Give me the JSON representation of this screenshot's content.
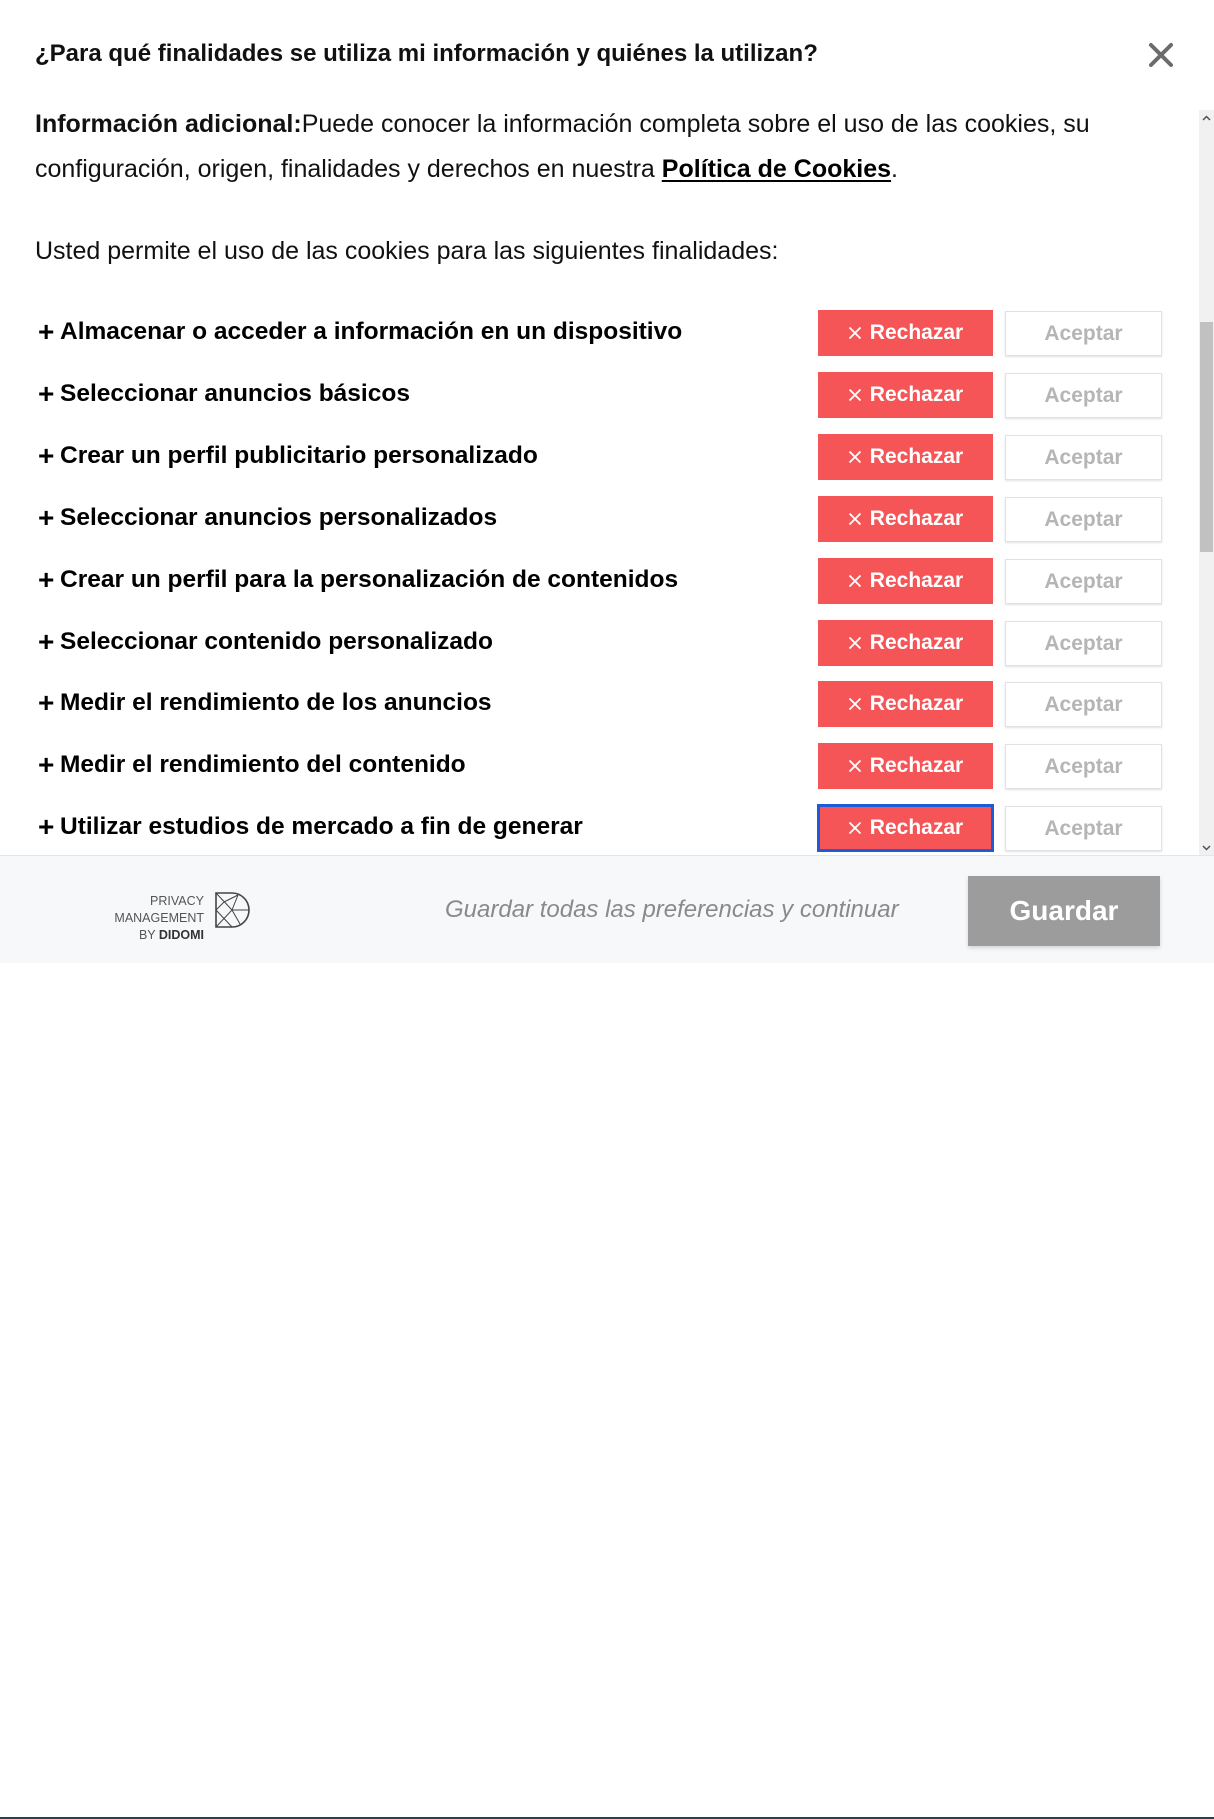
{
  "dialog": {
    "title": "¿Para qué finalidades se utiliza mi información y quiénes la utilizan?",
    "close_icon": "close-icon"
  },
  "info": {
    "bold_prefix": "Información adicional:",
    "text_before_link": "Puede conocer la información completa sobre el uso de las cookies, su configuración, origen, finalidades y derechos en nuestra ",
    "link_label": "Política de Cookies",
    "text_after_link": "."
  },
  "allow_intro": "Usted permite el uso de las cookies para las siguientes finalidades:",
  "reject_label": "Rechazar",
  "accept_label": "Aceptar",
  "purposes": [
    {
      "label": "Almacenar o acceder a información en un dispositivo"
    },
    {
      "label": "Seleccionar anuncios básicos"
    },
    {
      "label": "Crear un perfil publicitario personalizado"
    },
    {
      "label": "Seleccionar anuncios personalizados"
    },
    {
      "label": "Crear un perfil para la personalización de contenidos"
    },
    {
      "label": "Seleccionar contenido personalizado"
    },
    {
      "label": "Medir el rendimiento de los anuncios"
    },
    {
      "label": "Medir el rendimiento del contenido"
    },
    {
      "label": "Utilizar estudios de mercado a fin de generar"
    }
  ],
  "footer": {
    "brand_line1": "PRIVACY MANAGEMENT",
    "brand_line2_prefix": "BY ",
    "brand_line2_name": "DIDOMI",
    "save_all_text": "Guardar todas las preferencias y continuar",
    "save_button": "Guardar"
  },
  "colors": {
    "reject_bg": "#f65558",
    "save_bg": "#9c9c9c",
    "focus_outline": "#1f5bd6"
  }
}
